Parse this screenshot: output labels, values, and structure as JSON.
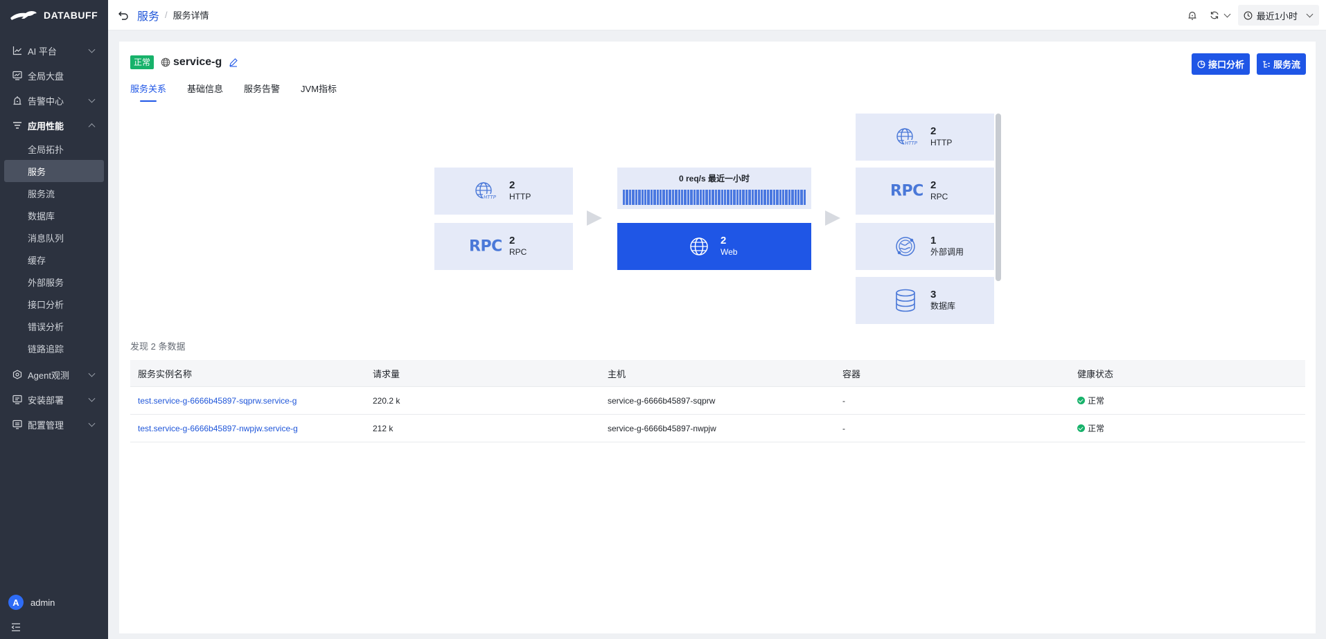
{
  "app": {
    "brand": "DATABUFF"
  },
  "sidebar": {
    "items": [
      {
        "label": "AI 平台",
        "icon": "chart-icon"
      },
      {
        "label": "全局大盘",
        "icon": "dashboard-icon"
      },
      {
        "label": "告警中心",
        "icon": "alarm-icon"
      },
      {
        "label": "应用性能",
        "icon": "filter-list-icon"
      }
    ],
    "sub_items": [
      "全局拓扑",
      "服务",
      "服务流",
      "数据库",
      "消息队列",
      "缓存",
      "外部服务",
      "接口分析",
      "错误分析",
      "链路追踪"
    ],
    "bottom_items": [
      {
        "label": "Agent观测",
        "icon": "agent-icon"
      },
      {
        "label": "安装部署",
        "icon": "install-icon"
      },
      {
        "label": "配置管理",
        "icon": "config-icon"
      }
    ],
    "user": {
      "initial": "A",
      "name": "admin"
    }
  },
  "header": {
    "breadcrumb_root": "服务",
    "breadcrumb_sep": "/",
    "breadcrumb_current": "服务详情",
    "time_range": "最近1小时"
  },
  "service": {
    "status": "正常",
    "name": "service-g"
  },
  "actions": {
    "interface_analysis": "接口分析",
    "service_flow": "服务流"
  },
  "tabs": [
    "服务关系",
    "基础信息",
    "服务告警",
    "JVM指标"
  ],
  "topology": {
    "upstream": [
      {
        "count": "2",
        "label": "HTTP",
        "icon": "http-globe-icon"
      },
      {
        "count": "2",
        "label": "RPC",
        "icon": "rpc-icon"
      }
    ],
    "center": {
      "rate": "0 req/s  最近一小时",
      "count": "2",
      "label": "Web",
      "icon": "globe-icon"
    },
    "downstream": [
      {
        "count": "2",
        "label": "HTTP",
        "icon": "http-globe-icon"
      },
      {
        "count": "2",
        "label": "RPC",
        "icon": "rpc-icon"
      },
      {
        "count": "1",
        "label": "外部调用",
        "icon": "external-call-icon"
      },
      {
        "count": "3",
        "label": "数据库",
        "icon": "database-icon"
      }
    ],
    "rpc_glyph": "RPC",
    "http_glyph": "HTTP",
    "colors": {
      "card": "#e5eaf8",
      "center": "#1f56e6",
      "icon": "#4a78d8"
    }
  },
  "table": {
    "found_text": "发现 2 条数据",
    "columns": [
      "服务实例名称",
      "请求量",
      "主机",
      "容器",
      "健康状态"
    ],
    "rows": [
      {
        "name": "test.service-g-6666b45897-sqprw.service-g",
        "requests": "220.2 k",
        "host": "service-g-6666b45897-sqprw",
        "container": "-",
        "health": "正常"
      },
      {
        "name": "test.service-g-6666b45897-nwpjw.service-g",
        "requests": "212 k",
        "host": "service-g-6666b45897-nwpjw",
        "container": "-",
        "health": "正常"
      }
    ]
  }
}
